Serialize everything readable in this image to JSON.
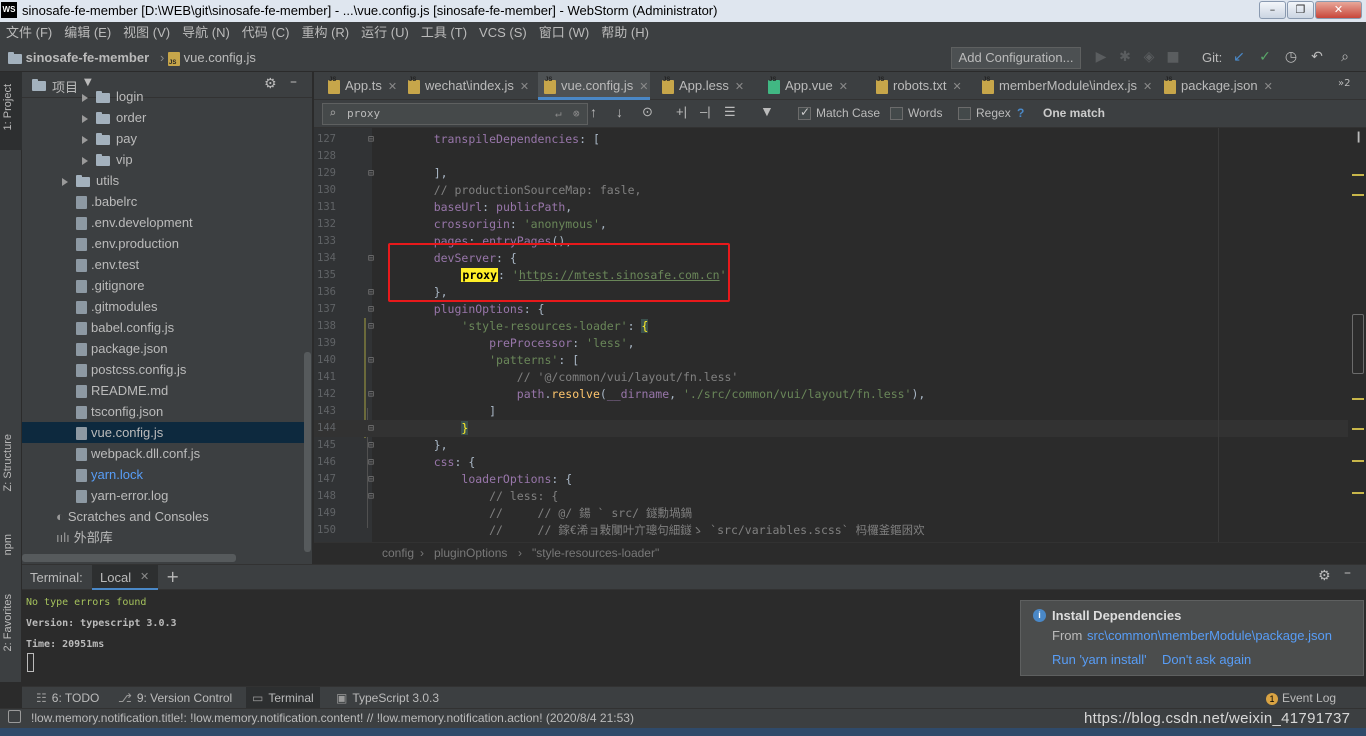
{
  "window": {
    "title": "sinosafe-fe-member [D:\\WEB\\git\\sinosafe-fe-member] - ...\\vue.config.js [sinosafe-fe-member] - WebStorm (Administrator)",
    "app_badge": "WS"
  },
  "menu": [
    "文件 (F)",
    "编辑 (E)",
    "视图 (V)",
    "导航 (N)",
    "代码 (C)",
    "重构 (R)",
    "运行 (U)",
    "工具 (T)",
    "VCS (S)",
    "窗口 (W)",
    "帮助 (H)"
  ],
  "navbar": {
    "project": "sinosafe-fe-member",
    "file": "vue.config.js",
    "add_config": "Add Configuration...",
    "git_label": "Git:"
  },
  "left_stripe": {
    "project": "1: Project",
    "structure": "Z: Structure",
    "npm": "npm",
    "favorites": "2: Favorites"
  },
  "project_panel": {
    "title": "项目",
    "tree": [
      {
        "label": "login",
        "type": "folder",
        "indent": 3,
        "arrow": true
      },
      {
        "label": "order",
        "type": "folder",
        "indent": 3,
        "arrow": true
      },
      {
        "label": "pay",
        "type": "folder",
        "indent": 3,
        "arrow": true
      },
      {
        "label": "vip",
        "type": "folder",
        "indent": 3,
        "arrow": true
      },
      {
        "label": "utils",
        "type": "folder",
        "indent": 2,
        "arrow": true
      },
      {
        "label": ".babelrc",
        "type": "file",
        "indent": 2
      },
      {
        "label": ".env.development",
        "type": "file",
        "indent": 2
      },
      {
        "label": ".env.production",
        "type": "file",
        "indent": 2
      },
      {
        "label": ".env.test",
        "type": "file",
        "indent": 2
      },
      {
        "label": ".gitignore",
        "type": "file",
        "indent": 2
      },
      {
        "label": ".gitmodules",
        "type": "file",
        "indent": 2
      },
      {
        "label": "babel.config.js",
        "type": "file",
        "indent": 2
      },
      {
        "label": "package.json",
        "type": "file",
        "indent": 2
      },
      {
        "label": "postcss.config.js",
        "type": "file",
        "indent": 2
      },
      {
        "label": "README.md",
        "type": "file",
        "indent": 2
      },
      {
        "label": "tsconfig.json",
        "type": "file",
        "indent": 2
      },
      {
        "label": "vue.config.js",
        "type": "file",
        "indent": 2,
        "selected": true
      },
      {
        "label": "webpack.dll.conf.js",
        "type": "file",
        "indent": 2
      },
      {
        "label": "yarn.lock",
        "type": "file",
        "indent": 2,
        "blue": true
      },
      {
        "label": "yarn-error.log",
        "type": "file",
        "indent": 2
      },
      {
        "label": "Scratches and Consoles",
        "type": "scratch",
        "indent": 1
      },
      {
        "label": "外部库",
        "type": "lib",
        "indent": 1
      }
    ]
  },
  "tabs": [
    {
      "label": "App.ts"
    },
    {
      "label": "wechat\\index.js"
    },
    {
      "label": "vue.config.js",
      "active": true
    },
    {
      "label": "App.less"
    },
    {
      "label": "App.vue"
    },
    {
      "label": "robots.txt"
    },
    {
      "label": "memberModule\\index.js"
    },
    {
      "label": "package.json"
    }
  ],
  "tabs_overflow": "»2",
  "find": {
    "query": "proxy",
    "match_case": "Match Case",
    "words": "Words",
    "regex": "Regex",
    "help": "?",
    "result": "One match"
  },
  "code": [
    {
      "n": "127",
      "html": "    <span class='p'>transpileDependencies</span>: ["
    },
    {
      "n": "128",
      "html": ""
    },
    {
      "n": "129",
      "html": "    ],"
    },
    {
      "n": "130",
      "html": "    <span class='c'>// productionSourceMap: fasle,</span>"
    },
    {
      "n": "131",
      "html": "    <span class='p'>baseUrl</span>: <span class='p'>publicPath</span>,"
    },
    {
      "n": "132",
      "html": "    <span class='p'>crossorigin</span>: <span class='s'>'anonymous'</span>,"
    },
    {
      "n": "133",
      "html": "    <span class='p'>pages</span>: <span class='p'>entryPages</span>(),"
    },
    {
      "n": "134",
      "html": "    <span class='p'>devServer</span>: {"
    },
    {
      "n": "135",
      "html": "        <span class='hl'>proxy</span>: <span class='s'>'<u>https://mtest.sinosafe.com.cn</u>'</span>"
    },
    {
      "n": "136",
      "html": "    },"
    },
    {
      "n": "137",
      "html": "    <span class='p'>pluginOptions</span>: {"
    },
    {
      "n": "138",
      "html": "        <span class='s'>'style-resources-loader'</span>: <span style='background:#3b514d;color:#ffef28'>{</span>"
    },
    {
      "n": "139",
      "html": "            <span class='p'>preProcessor</span>: <span class='s'>'less'</span>,"
    },
    {
      "n": "140",
      "html": "            <span class='s'>'patterns'</span>: ["
    },
    {
      "n": "141",
      "html": "                <span class='c'>// '@/common/vui/layout/fn.less'</span>"
    },
    {
      "n": "142",
      "html": "                <span class='p'>path</span>.<span class='f'>resolve</span>(<span class='p'>__dirname</span>, <span class='s'>'./src/common/vui/layout/fn.less'</span>),"
    },
    {
      "n": "143",
      "html": "            ]"
    },
    {
      "n": "144",
      "html": "        <span style='background:#3b514d;color:#ffef28'>}</span>",
      "current": true
    },
    {
      "n": "145",
      "html": "    },"
    },
    {
      "n": "146",
      "html": "    <span class='p'>css</span>: {"
    },
    {
      "n": "147",
      "html": "        <span class='p'>loaderOptions</span>: {"
    },
    {
      "n": "148",
      "html": "            <span class='c'>// less: {</span>"
    },
    {
      "n": "149",
      "html": "            <span class='c'>//     // @/ 鍚 ` src/ 鐩勳堝鍋</span>"
    },
    {
      "n": "150",
      "html": "            <span class='c'>//     // 鎵€浠ョ敤闃叶亣璁句細鐩ゝ `src/variables.scss` 杩欏釜鏂囦欢</span>"
    }
  ],
  "breadcrumb": [
    "config",
    "pluginOptions",
    "\"style-resources-loader\""
  ],
  "terminal": {
    "label": "Terminal:",
    "tab": "Local",
    "add": "+",
    "lines": [
      {
        "text": "No type errors found",
        "color": "#a5c25c"
      },
      {
        "text": "Version: typescript 3.0.3",
        "color": "#bbbbbb"
      },
      {
        "text": "Time: 20951ms",
        "color": "#bbbbbb"
      }
    ]
  },
  "notification": {
    "title": "Install Dependencies",
    "from_label": "From",
    "from_path": "src\\common\\memberModule\\package.json",
    "action1": "Run 'yarn install'",
    "action2": "Don't ask again"
  },
  "bottom_tabs": [
    {
      "label": "6: TODO"
    },
    {
      "label": "9: Version Control"
    },
    {
      "label": "Terminal",
      "active": true
    },
    {
      "label": "TypeScript 3.0.3"
    }
  ],
  "event_log": "Event Log",
  "event_count": "1",
  "status": "!low.memory.notification.title!: !low.memory.notification.content! // !low.memory.notification.action! (2020/8/4 21:53)",
  "watermark": "https://blog.csdn.net/weixin_41791737",
  "colors": {
    "accent": "#4a88c7",
    "highlight_box": "#e8191b",
    "find_highlight": "#ffef28"
  }
}
